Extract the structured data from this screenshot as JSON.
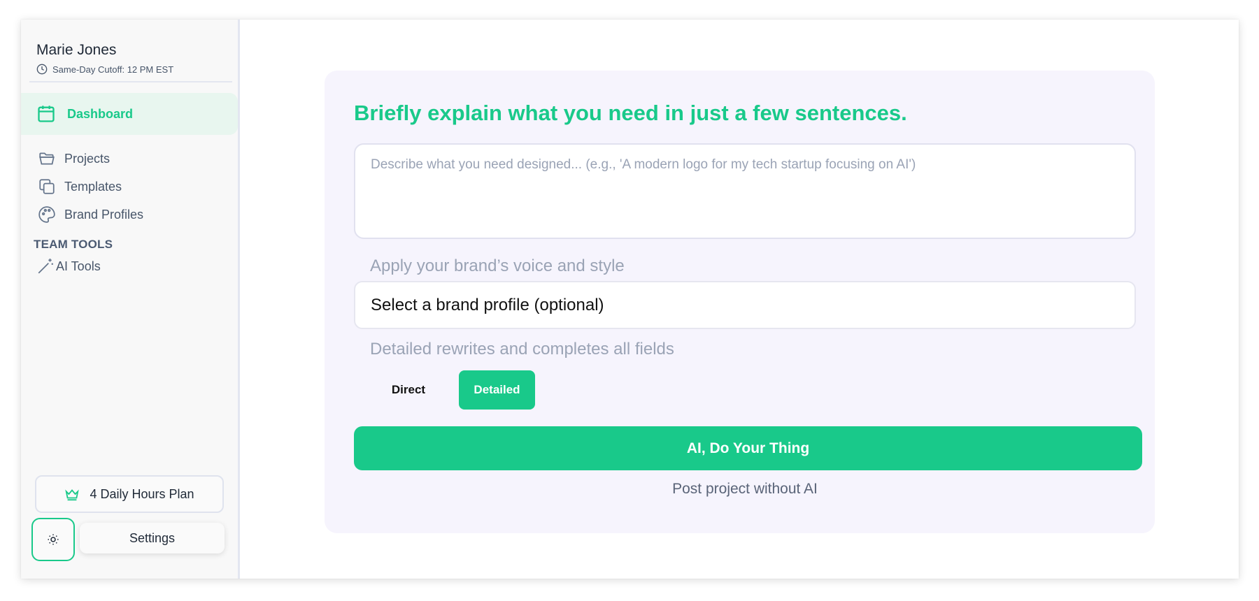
{
  "user": {
    "name": "Marie Jones",
    "cutoff": "Same-Day Cutoff: 12 PM EST"
  },
  "sidebar": {
    "active_item": {
      "label": "Dashboard",
      "icon": "calendar-icon"
    },
    "items": [
      {
        "label": "Projects",
        "icon": "folder-icon"
      },
      {
        "label": "Templates",
        "icon": "copy-icon"
      },
      {
        "label": "Brand Profiles",
        "icon": "palette-icon"
      }
    ],
    "section_label": "TEAM TOOLS",
    "tools": [
      {
        "label": "AI Tools",
        "icon": "magic-wand-icon"
      }
    ],
    "plan_label": "4 Daily Hours Plan",
    "settings_label": "Settings"
  },
  "form": {
    "headline": "Briefly explain what you need in just a few sentences.",
    "description_placeholder": "Describe what you need designed... (e.g., 'A modern logo for my tech startup focusing on AI')",
    "brand_label": "Apply your brand’s voice and style",
    "brand_select": "Select a brand profile (optional)",
    "mode_label": "Detailed rewrites and completes all fields",
    "mode_options": [
      "Direct",
      "Detailed"
    ],
    "mode_selected": "Detailed",
    "primary_button": "AI, Do Your Thing",
    "secondary_link": "Post project without AI"
  },
  "colors": {
    "accent": "#19c98a",
    "card_background": "#f6f4fd",
    "sidebar_background": "#f8f8f8"
  }
}
